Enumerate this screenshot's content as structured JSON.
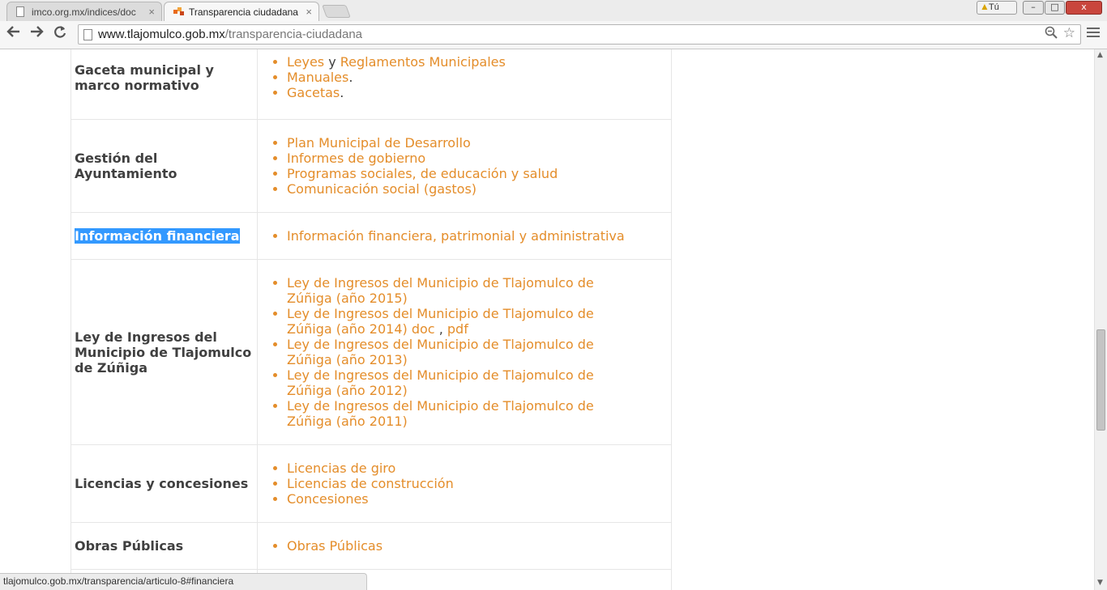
{
  "browser": {
    "tabs": [
      {
        "title": "imco.org.mx/indices/doc",
        "close": "×",
        "active": false
      },
      {
        "title": "Transparencia ciudadana",
        "close": "×",
        "active": true
      }
    ],
    "profile_label": "Tú",
    "window_buttons": {
      "minimize": "–",
      "maximize": "□",
      "close": "x"
    },
    "url_domain": "www.tlajomulco.gob.mx",
    "url_path": "/transparencia-ciudadana",
    "status_url": "tlajomulco.gob.mx/transparencia/articulo-8#financiera"
  },
  "icons": {
    "back": "arrow-left-icon",
    "forward": "arrow-right-icon",
    "reload": "reload-icon",
    "page": "page-icon",
    "zoom": "zoom-icon",
    "star": "star-icon",
    "menu": "hamburger-menu-icon"
  },
  "colors": {
    "link": "#e48d2a",
    "text": "#404040",
    "selection": "#3399ff"
  },
  "table": {
    "rows": [
      {
        "category": "Gaceta municipal y marco normativo"
      },
      {
        "category": "Gestión del Ayuntamiento",
        "links": [
          "Plan Municipal de Desarrollo",
          "Informes de gobierno",
          "Programas sociales, de educación y salud",
          "Comunicación social (gastos)"
        ]
      },
      {
        "category": "Información financiera",
        "links": [
          "Información financiera, patrimonial y administrativa"
        ]
      },
      {
        "category": "Ley de Ingresos del Municipio de Tlajomulco de Zúñiga",
        "links": [
          "Ley de Ingresos del Municipio de Tlajomulco de Zúñiga (año 2015)",
          "Ley de Ingresos del Municipio de Tlajomulco de Zúñiga (año 2014) doc",
          "Ley de Ingresos del Municipio de Tlajomulco de Zúñiga (año 2013)",
          "Ley de Ingresos del Municipio de Tlajomulco de Zúñiga (año 2012)",
          "Ley de Ingresos del Municipio de Tlajomulco de Zúñiga (año 2011)"
        ]
      },
      {
        "category": "Licencias y concesiones",
        "links": [
          "Licencias de giro",
          "Licencias de construcción",
          "Concesiones"
        ]
      },
      {
        "category": "Obras Públicas",
        "links": [
          "Obras Públicas"
        ]
      }
    ],
    "gaceta": {
      "leyes": "Leyes",
      "y": "y",
      "reglamentos": "Reglamentos Municipales",
      "manuales": "Manuales",
      "gacetas": "Gacetas",
      "period": "."
    },
    "ley2014_separator": ",",
    "ley2014_pdf": "pdf"
  }
}
